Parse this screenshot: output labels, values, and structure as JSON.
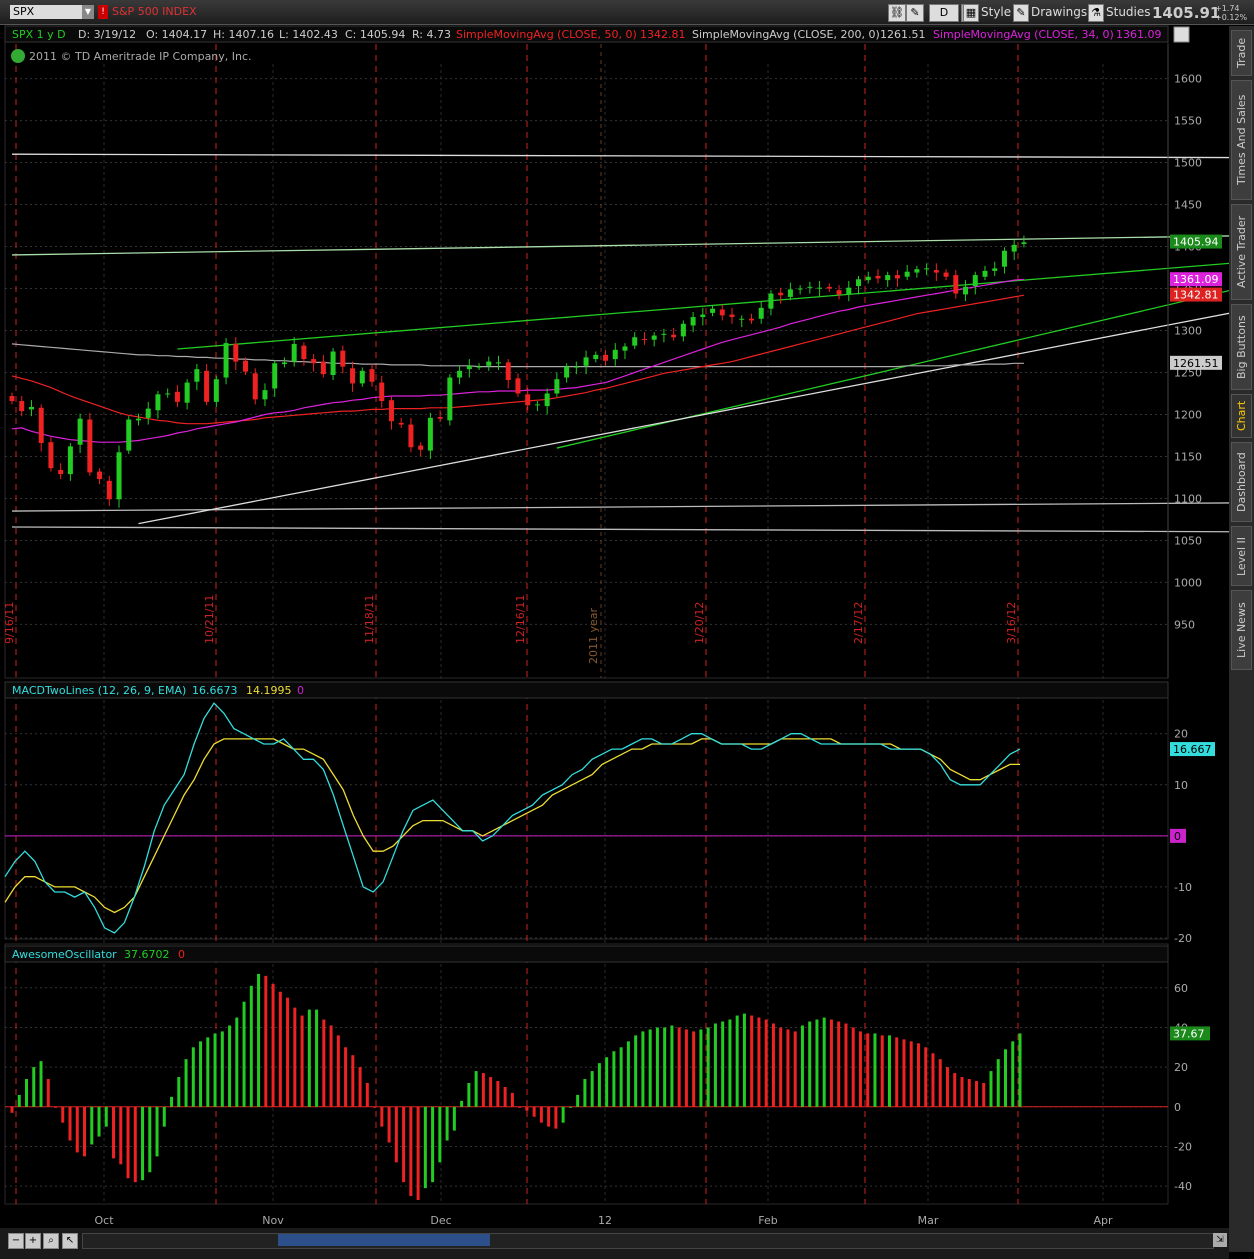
{
  "toolbar": {
    "symbol": "SPX",
    "description": "S&P 500 INDEX",
    "flag": "!",
    "period_button": "D",
    "style_label": "Style",
    "drawings_label": "Drawings",
    "studies_label": "Studies",
    "last_price": "1405.91",
    "change_abs": "+1.74",
    "change_pct": "+0.12%"
  },
  "header": {
    "symbol_period": "SPX 1 y D",
    "date": "D: 3/19/12",
    "open": "O: 1404.17",
    "high": "H: 1407.16",
    "low": "L: 1402.43",
    "close": "C: 1405.94",
    "range": "R: 4.73",
    "sma50_label": "SimpleMovingAvg (CLOSE, 50, 0)",
    "sma50_value": "1342.81",
    "sma200_label": "SimpleMovingAvg (CLOSE, 200, 0)",
    "sma200_value": "1261.51",
    "sma34_label": "SimpleMovingAvg (CLOSE, 34, 0)",
    "sma34_value": "1361.09",
    "copyright": "2011 © TD Ameritrade IP Company, Inc."
  },
  "macd_header": {
    "label": "MACDTwoLines (12, 26, 9, EMA)",
    "value": "16.6673",
    "avg": "14.1995",
    "diff": "0"
  },
  "ao_header": {
    "label": "AwesomeOscillator",
    "value": "37.6702",
    "extra": "0"
  },
  "right_tabs": [
    "Trade",
    "Times And Sales",
    "Active Trader",
    "Big Buttons",
    "Chart",
    "Dashboard",
    "Level II",
    "Live News"
  ],
  "active_tab": "Chart",
  "colors": {
    "up": "#22cc22",
    "down": "#ee2222",
    "sma50": "#ee2222",
    "sma200": "#aaaaaa",
    "sma34": "#dd22dd",
    "macd": "#33dddd",
    "macd_avg": "#eedd33",
    "zero": "#cc22cc",
    "grid": "#333333",
    "marker": "#cc2222"
  },
  "chart_data": [
    {
      "type": "candlestick",
      "title": "S&P 500 INDEX",
      "symbol": "SPX",
      "ylim": [
        910,
        1640
      ],
      "y_ticks": [
        950,
        1000,
        1050,
        1100,
        1150,
        1200,
        1250,
        1300,
        1350,
        1400,
        1450,
        1500,
        1550,
        1600
      ],
      "date_markers": [
        "9/16/11",
        "10/21/11",
        "11/18/11",
        "12/16/11",
        "1/20/12",
        "2/17/12",
        "3/16/12"
      ],
      "year_marker": "2011 year",
      "month_labels": [
        "Oct",
        "Nov",
        "Dec",
        "12",
        "Feb",
        "Mar",
        "Apr"
      ],
      "price_flags": {
        "last": "1405.94",
        "sma34": "1361.09",
        "sma50": "1342.81",
        "sma200": "1261.51"
      },
      "close": [
        1216,
        1204,
        1209,
        1166,
        1136,
        1129,
        1162,
        1195,
        1131,
        1123,
        1099,
        1155,
        1194,
        1195,
        1207,
        1224,
        1225,
        1215,
        1238,
        1254,
        1215,
        1242,
        1285,
        1263,
        1251,
        1218,
        1229,
        1261,
        1262,
        1284,
        1266,
        1261,
        1248,
        1275,
        1257,
        1237,
        1252,
        1239,
        1216,
        1192,
        1188,
        1161,
        1158,
        1196,
        1195,
        1244,
        1252,
        1258,
        1257,
        1263,
        1262,
        1241,
        1225,
        1211,
        1212,
        1225,
        1242,
        1257,
        1257,
        1268,
        1271,
        1264,
        1277,
        1281,
        1292,
        1289,
        1294,
        1296,
        1292,
        1308,
        1316,
        1319,
        1326,
        1318,
        1316,
        1314,
        1312,
        1327,
        1344,
        1342,
        1349,
        1350,
        1352,
        1351,
        1350,
        1343,
        1351,
        1361,
        1364,
        1362,
        1366,
        1362,
        1370,
        1373,
        1374,
        1369,
        1364,
        1344,
        1352,
        1366,
        1371,
        1374,
        1395,
        1402,
        1405
      ],
      "sma34": [
        1183,
        1184,
        1180,
        1177,
        1174,
        1172,
        1170,
        1169,
        1168,
        1167,
        1167,
        1167,
        1168,
        1169,
        1171,
        1173,
        1175,
        1178,
        1180,
        1183,
        1185,
        1187,
        1189,
        1191,
        1194,
        1197,
        1200,
        1202,
        1203,
        1205,
        1208,
        1210,
        1212,
        1214,
        1215,
        1217,
        1218,
        1220,
        1221,
        1222,
        1222,
        1222,
        1222,
        1223,
        1223,
        1224,
        1225,
        1226,
        1227,
        1227,
        1228,
        1228,
        1228,
        1229,
        1229,
        1229,
        1230,
        1231,
        1232,
        1234,
        1236,
        1238,
        1242,
        1246,
        1250,
        1254,
        1258,
        1262,
        1266,
        1270,
        1274,
        1278,
        1282,
        1286,
        1289,
        1292,
        1295,
        1298,
        1301,
        1304,
        1308,
        1311,
        1314,
        1317,
        1320,
        1323,
        1325,
        1328,
        1330,
        1332,
        1334,
        1336,
        1338,
        1340,
        1342,
        1344,
        1346,
        1348,
        1350,
        1352,
        1354,
        1356,
        1358,
        1360,
        1361
      ],
      "sma50": [
        1246,
        1243,
        1240,
        1236,
        1232,
        1227,
        1222,
        1218,
        1214,
        1210,
        1206,
        1202,
        1199,
        1197,
        1195,
        1193,
        1192,
        1190,
        1189,
        1189,
        1189,
        1190,
        1191,
        1192,
        1193,
        1194,
        1196,
        1197,
        1198,
        1199,
        1200,
        1201,
        1202,
        1203,
        1204,
        1204,
        1205,
        1206,
        1206,
        1207,
        1207,
        1207,
        1207,
        1208,
        1208,
        1208,
        1209,
        1210,
        1211,
        1212,
        1213,
        1214,
        1215,
        1216,
        1217,
        1218,
        1220,
        1222,
        1224,
        1226,
        1229,
        1231,
        1234,
        1237,
        1240,
        1243,
        1246,
        1249,
        1251,
        1253,
        1255,
        1257,
        1259,
        1261,
        1263,
        1266,
        1269,
        1272,
        1275,
        1278,
        1281,
        1284,
        1287,
        1290,
        1293,
        1296,
        1299,
        1302,
        1305,
        1308,
        1311,
        1314,
        1317,
        1320,
        1322,
        1324,
        1326,
        1328,
        1330,
        1332,
        1334,
        1336,
        1338,
        1340,
        1342
      ],
      "sma200": [
        1284,
        1283,
        1282,
        1281,
        1280,
        1279,
        1278,
        1277,
        1276,
        1275,
        1274,
        1273,
        1272,
        1271,
        1271,
        1270,
        1270,
        1269,
        1269,
        1268,
        1268,
        1267,
        1267,
        1266,
        1266,
        1265,
        1265,
        1264,
        1264,
        1263,
        1263,
        1262,
        1262,
        1261,
        1261,
        1261,
        1260,
        1260,
        1260,
        1259,
        1259,
        1259,
        1259,
        1258,
        1258,
        1258,
        1258,
        1258,
        1257,
        1257,
        1257,
        1257,
        1257,
        1257,
        1257,
        1257,
        1257,
        1257,
        1257,
        1257,
        1257,
        1257,
        1257,
        1257,
        1257,
        1257,
        1257,
        1257,
        1257,
        1257,
        1257,
        1257,
        1257,
        1257,
        1257,
        1257,
        1257,
        1257,
        1257,
        1257,
        1257,
        1257,
        1257,
        1257,
        1257,
        1257,
        1257,
        1257,
        1257,
        1257,
        1257,
        1257,
        1258,
        1258,
        1258,
        1258,
        1258,
        1259,
        1259,
        1259,
        1260,
        1260,
        1260,
        1261,
        1261
      ],
      "trendlines": [
        {
          "color": "#dddddd",
          "points": [
            [
              0,
              1510
            ],
            [
              155,
              1505
            ]
          ]
        },
        {
          "color": "#bbbbbb",
          "points": [
            [
              0,
              1066
            ],
            [
              155,
              1059
            ]
          ]
        },
        {
          "color": "#bbbbbb",
          "points": [
            [
              0,
              1085
            ],
            [
              155,
              1097
            ]
          ]
        },
        {
          "color": "#aaddaa",
          "points": [
            [
              0,
              1390
            ],
            [
              155,
              1418
            ]
          ]
        },
        {
          "color": "#22cc22",
          "points": [
            [
              17,
              1278
            ],
            [
              140,
              1394
            ]
          ]
        },
        {
          "color": "#22cc22",
          "points": [
            [
              56,
              1160
            ],
            [
              140,
              1388
            ]
          ]
        },
        {
          "color": "#dddddd",
          "points": [
            [
              13,
              1070
            ],
            [
              145,
              1365
            ]
          ]
        }
      ]
    },
    {
      "type": "line",
      "title": "MACDTwoLines (12, 26, 9, EMA)",
      "ylim": [
        -20,
        27
      ],
      "y_ticks": [
        -20,
        -10,
        0,
        10,
        20
      ],
      "last_label": "16.667",
      "zero_label": "0",
      "series": [
        {
          "name": "Value",
          "values": [
            -8,
            -5,
            -3,
            -5,
            -9,
            -11,
            -11,
            -12,
            -11,
            -14,
            -18,
            -19,
            -17,
            -12,
            -6,
            1,
            6,
            9,
            12,
            18,
            23,
            26,
            24,
            21,
            20,
            19,
            18,
            18,
            19,
            17,
            15,
            15,
            13,
            8,
            2,
            -4,
            -10,
            -11,
            -9,
            -4,
            1,
            5,
            6,
            7,
            5,
            3,
            1,
            1,
            -1,
            0,
            2,
            4,
            5,
            6,
            8,
            9,
            10,
            12,
            13,
            15,
            16,
            17,
            17,
            18,
            19,
            19,
            18,
            18,
            19,
            20,
            20,
            19,
            18,
            18,
            18,
            17,
            17,
            18,
            19,
            20,
            20,
            19,
            18,
            18,
            18,
            18,
            18,
            18,
            18,
            17,
            17,
            17,
            17,
            16,
            14,
            11,
            10,
            10,
            10,
            12,
            14,
            16,
            17
          ]
        },
        {
          "name": "Avg",
          "values": [
            -13,
            -10,
            -8,
            -8,
            -9,
            -10,
            -10,
            -10,
            -11,
            -12,
            -14,
            -15,
            -14,
            -12,
            -8,
            -4,
            0,
            4,
            8,
            11,
            15,
            18,
            19,
            19,
            19,
            19,
            19,
            19,
            18,
            17,
            17,
            16,
            15,
            12,
            9,
            4,
            0,
            -3,
            -3,
            -2,
            0,
            2,
            3,
            3,
            3,
            2,
            1,
            1,
            0,
            1,
            2,
            3,
            4,
            5,
            6,
            8,
            9,
            10,
            11,
            12,
            14,
            15,
            16,
            17,
            17,
            18,
            18,
            18,
            18,
            18,
            19,
            19,
            18,
            18,
            18,
            18,
            18,
            18,
            19,
            19,
            19,
            19,
            19,
            19,
            18,
            18,
            18,
            18,
            18,
            18,
            17,
            17,
            17,
            16,
            15,
            13,
            12,
            11,
            11,
            12,
            13,
            14,
            14
          ]
        }
      ]
    },
    {
      "type": "bar",
      "title": "AwesomeOscillator",
      "ylim": [
        -48,
        73
      ],
      "y_ticks": [
        -40,
        -20,
        0,
        20,
        40,
        60
      ],
      "last_label": "37.67",
      "values": [
        -3,
        6,
        14,
        20,
        23,
        14,
        0,
        -8,
        -17,
        -23,
        -25,
        -19,
        -15,
        -10,
        -26,
        -29,
        -36,
        -38,
        -37,
        -33,
        -25,
        -10,
        5,
        15,
        24,
        30,
        33,
        35,
        37,
        38,
        41,
        45,
        53,
        61,
        67,
        66,
        62,
        58,
        55,
        50,
        46,
        49,
        49,
        44,
        41,
        36,
        30,
        26,
        20,
        12,
        0,
        -10,
        -18,
        -28,
        -38,
        -45,
        -47,
        -41,
        -38,
        -28,
        -17,
        -12,
        3,
        12,
        18,
        17,
        15,
        13,
        10,
        7,
        0,
        -2,
        -5,
        -8,
        -10,
        -11,
        -8,
        0,
        6,
        14,
        18,
        22,
        25,
        28,
        30,
        33,
        36,
        38,
        39,
        40,
        40,
        41,
        40,
        39,
        38,
        39,
        40,
        42,
        43,
        44,
        46,
        47,
        46,
        45,
        44,
        42,
        40,
        39,
        38,
        41,
        43,
        44,
        45,
        44,
        43,
        42,
        40,
        38,
        37,
        37,
        36,
        36,
        35,
        34,
        33,
        32,
        30,
        27,
        24,
        20,
        17,
        15,
        14,
        13,
        12,
        18,
        24,
        29,
        33,
        37
      ]
    }
  ]
}
